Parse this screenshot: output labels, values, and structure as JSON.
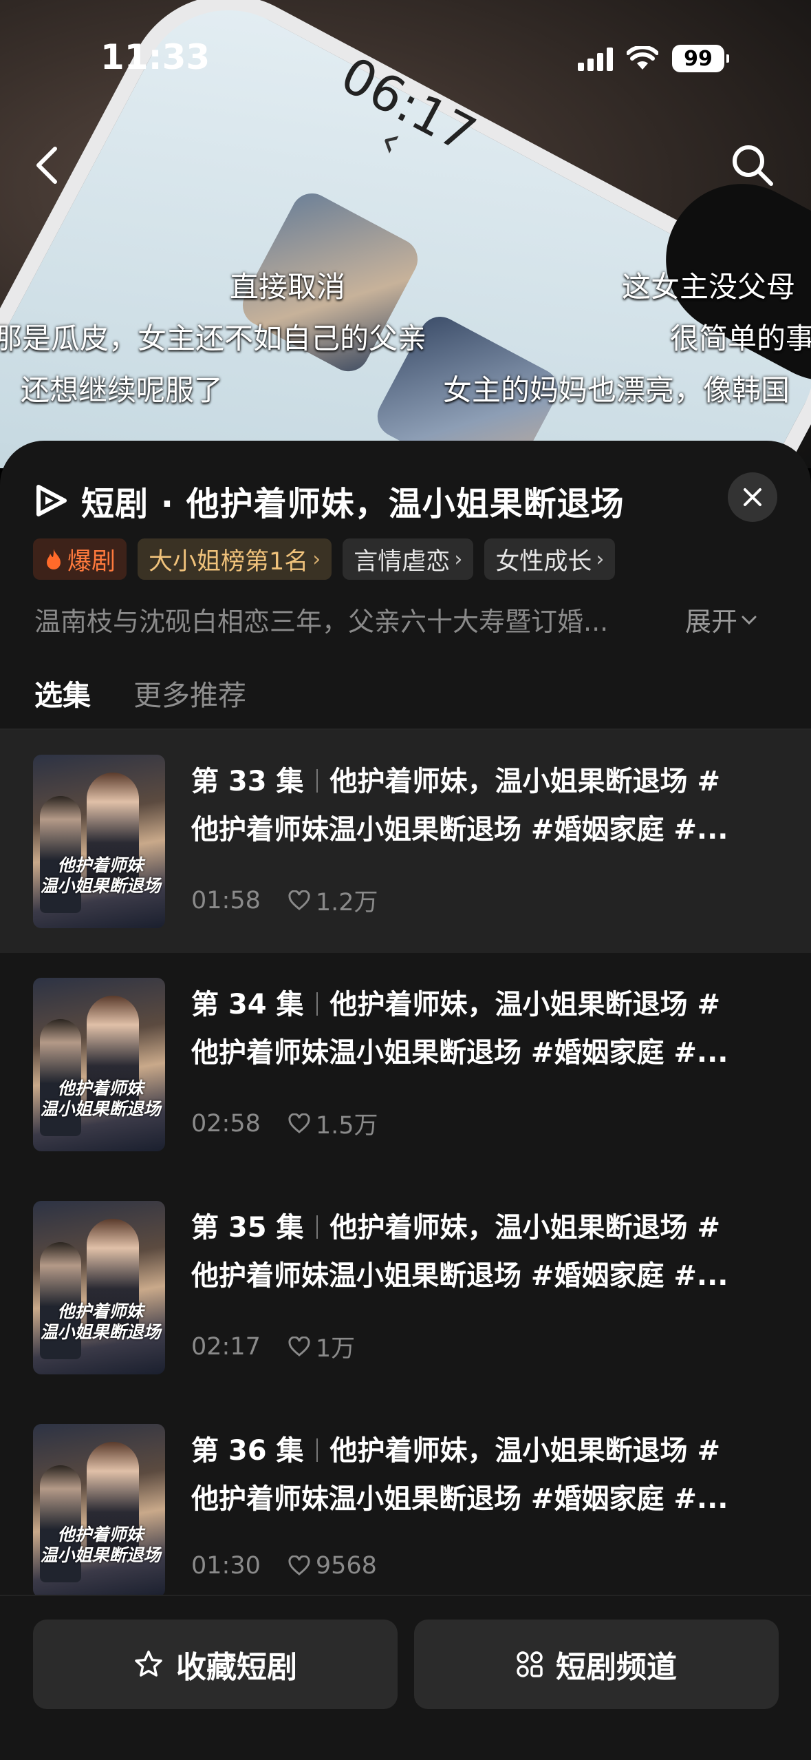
{
  "status_bar": {
    "time": "11:33",
    "battery": "99"
  },
  "video": {
    "phone_time": "06:17",
    "danmaku": [
      "直接取消",
      "这女主没父母",
      "那是瓜皮，女主还不如自己的父亲",
      "很简单的事",
      "还想继续呢服了",
      "女主的妈妈也漂亮，像韩国"
    ]
  },
  "sheet": {
    "title": "短剧 · 他护着师妹，温小姐果断退场",
    "tags": [
      {
        "label": "爆剧",
        "type": "hot"
      },
      {
        "label": "大小姐榜第1名",
        "type": "rank"
      },
      {
        "label": "言情虐恋",
        "type": "normal"
      },
      {
        "label": "女性成长",
        "type": "normal"
      }
    ],
    "description": "温南枝与沈砚白相恋三年，父亲六十大寿暨订婚...",
    "expand_label": "展开",
    "tabs": [
      {
        "label": "选集",
        "active": true
      },
      {
        "label": "更多推荐",
        "active": false
      }
    ]
  },
  "episodes": [
    {
      "number": "第 33 集",
      "title_line1": "他护着师妹，温小姐果断退场 #",
      "title_line2": "他护着师妹温小姐果断退场 #婚姻家庭 #...",
      "duration": "01:58",
      "likes": "1.2万",
      "thumb_title": "他护着师妹\n温小姐果断退场",
      "current": true
    },
    {
      "number": "第 34 集",
      "title_line1": "他护着师妹，温小姐果断退场 #",
      "title_line2": "他护着师妹温小姐果断退场 #婚姻家庭 #...",
      "duration": "02:58",
      "likes": "1.5万",
      "thumb_title": "他护着师妹\n温小姐果断退场",
      "current": false
    },
    {
      "number": "第 35 集",
      "title_line1": "他护着师妹，温小姐果断退场 #",
      "title_line2": "他护着师妹温小姐果断退场 #婚姻家庭 #...",
      "duration": "02:17",
      "likes": "1万",
      "thumb_title": "他护着师妹\n温小姐果断退场",
      "current": false
    },
    {
      "number": "第 36 集",
      "title_line1": "他护着师妹，温小姐果断退场 #",
      "title_line2": "他护着师妹温小姐果断退场 #婚姻家庭 #...",
      "duration": "01:30",
      "likes": "9568",
      "thumb_title": "他护着师妹\n温小姐果断退场",
      "current": false
    }
  ],
  "bottom_bar": {
    "favorite_label": "收藏短剧",
    "channel_label": "短剧频道"
  },
  "colors": {
    "accent": "#ffb400",
    "hot": "#ff7a3d",
    "rank": "#f0c27b",
    "sheet_bg": "#161616"
  }
}
